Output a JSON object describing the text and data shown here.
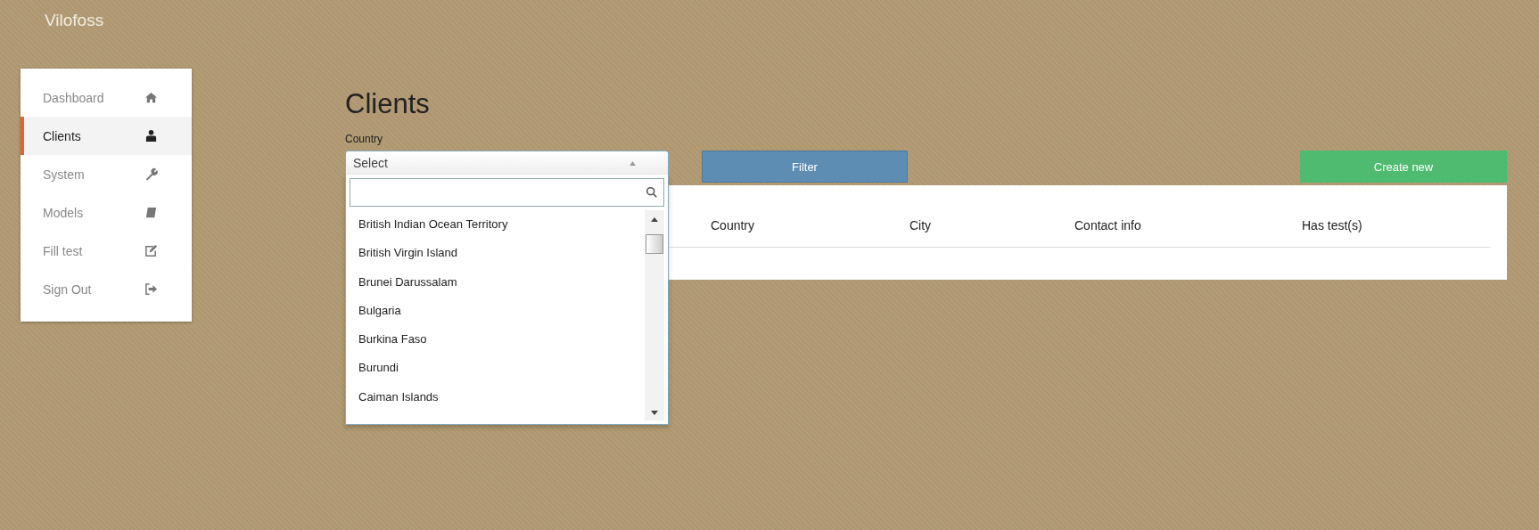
{
  "brand": "Vilofoss",
  "sidebar": {
    "items": [
      {
        "label": "Dashboard",
        "kind": "house",
        "selected": false
      },
      {
        "label": "Clients",
        "kind": "person",
        "selected": true
      },
      {
        "label": "System",
        "kind": "wrench",
        "selected": false
      },
      {
        "label": "Models",
        "kind": "book",
        "selected": false
      },
      {
        "label": "Fill test",
        "kind": "edit",
        "selected": false
      },
      {
        "label": "Sign Out",
        "kind": "signout",
        "selected": false
      }
    ]
  },
  "page": {
    "title": "Clients"
  },
  "filter": {
    "label": "Country",
    "select": {
      "value": "Select",
      "expanded": true,
      "options": [
        "British Indian Ocean Territory",
        "British Virgin Island",
        "Brunei Darussalam",
        "Bulgaria",
        "Burkina Faso",
        "Burundi",
        "Caiman Islands"
      ]
    },
    "button": "Filter"
  },
  "create_button": "Create new",
  "table": {
    "columns": [
      "Country",
      "City",
      "Contact info",
      "Has test(s)"
    ]
  }
}
